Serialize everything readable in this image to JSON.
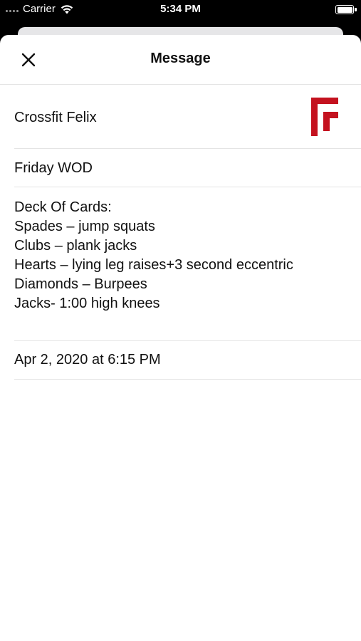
{
  "status_bar": {
    "carrier": "Carrier",
    "time": "5:34 PM"
  },
  "nav": {
    "title": "Message",
    "close_icon": "close-icon"
  },
  "message": {
    "sender": "Crossfit Felix",
    "logo_icon": "crossfit-felix-logo",
    "brand_color": "#c4121f",
    "subject": "Friday WOD",
    "body_lines": [
      "Deck Of Cards:",
      "Spades – jump squats",
      "Clubs – plank jacks",
      "Hearts – lying leg raises+3 second eccentric",
      "Diamonds – Burpees",
      "Jacks- 1:00 high knees"
    ],
    "date": "Apr 2, 2020 at 6:15 PM"
  }
}
